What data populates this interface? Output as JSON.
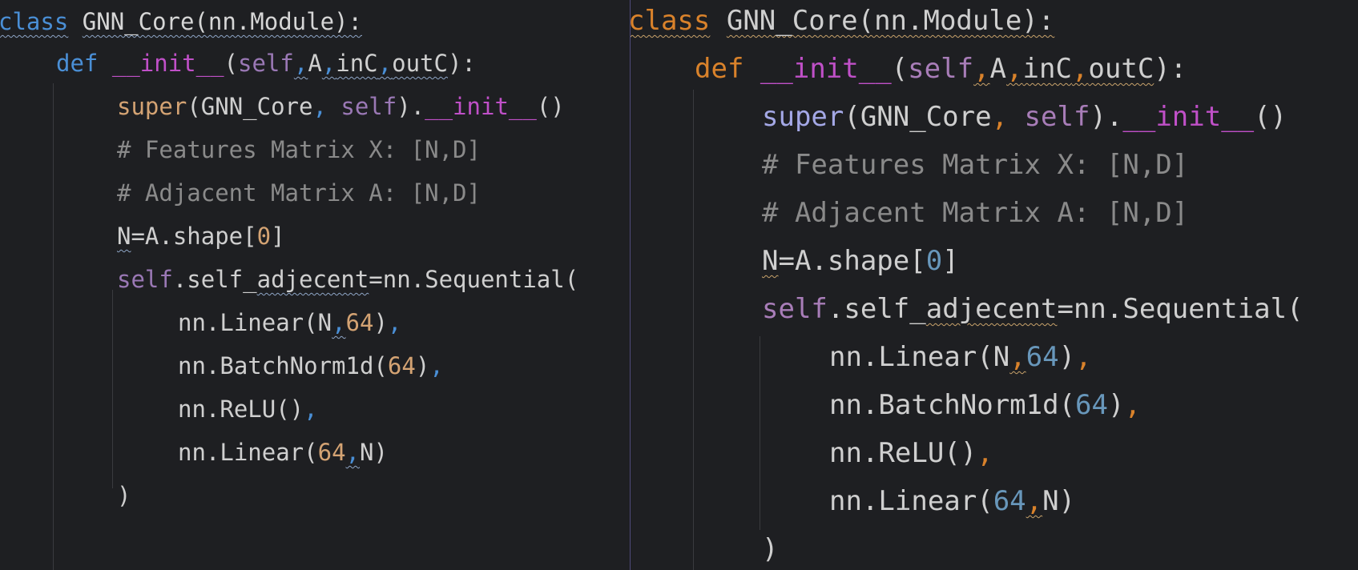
{
  "panes": [
    {
      "theme": "left",
      "lines": [
        "class GNN_Core(nn.Module):",
        "    def __init__(self,A,inC,outC):",
        "        super(GNN_Core, self).__init__()",
        "        # Features Matrix X: [N,D]",
        "        # Adjacent Matrix A: [N,D]",
        "        N=A.shape[0]",
        "        self.self_adjecent=nn.Sequential(",
        "            nn.Linear(N,64),",
        "            nn.BatchNorm1d(64),",
        "            nn.ReLU(),",
        "            nn.Linear(64,N)",
        "        )"
      ]
    },
    {
      "theme": "right",
      "lines": [
        "class GNN_Core(nn.Module):",
        "    def __init__(self,A,inC,outC):",
        "        super(GNN_Core, self).__init__()",
        "        # Features Matrix X: [N,D]",
        "        # Adjacent Matrix A: [N,D]",
        "        N=A.shape[0]",
        "        self.self_adjecent=nn.Sequential(",
        "            nn.Linear(N,64),",
        "            nn.BatchNorm1d(64),",
        "            nn.ReLU(),",
        "            nn.Linear(64,N)",
        "        )"
      ]
    }
  ],
  "colors": {
    "background": "#1e1f22",
    "left_keyword": "#4a8fd6",
    "right_keyword": "#d9822b",
    "magic_method": "#c050c8",
    "comment": "#8a8a8a"
  }
}
